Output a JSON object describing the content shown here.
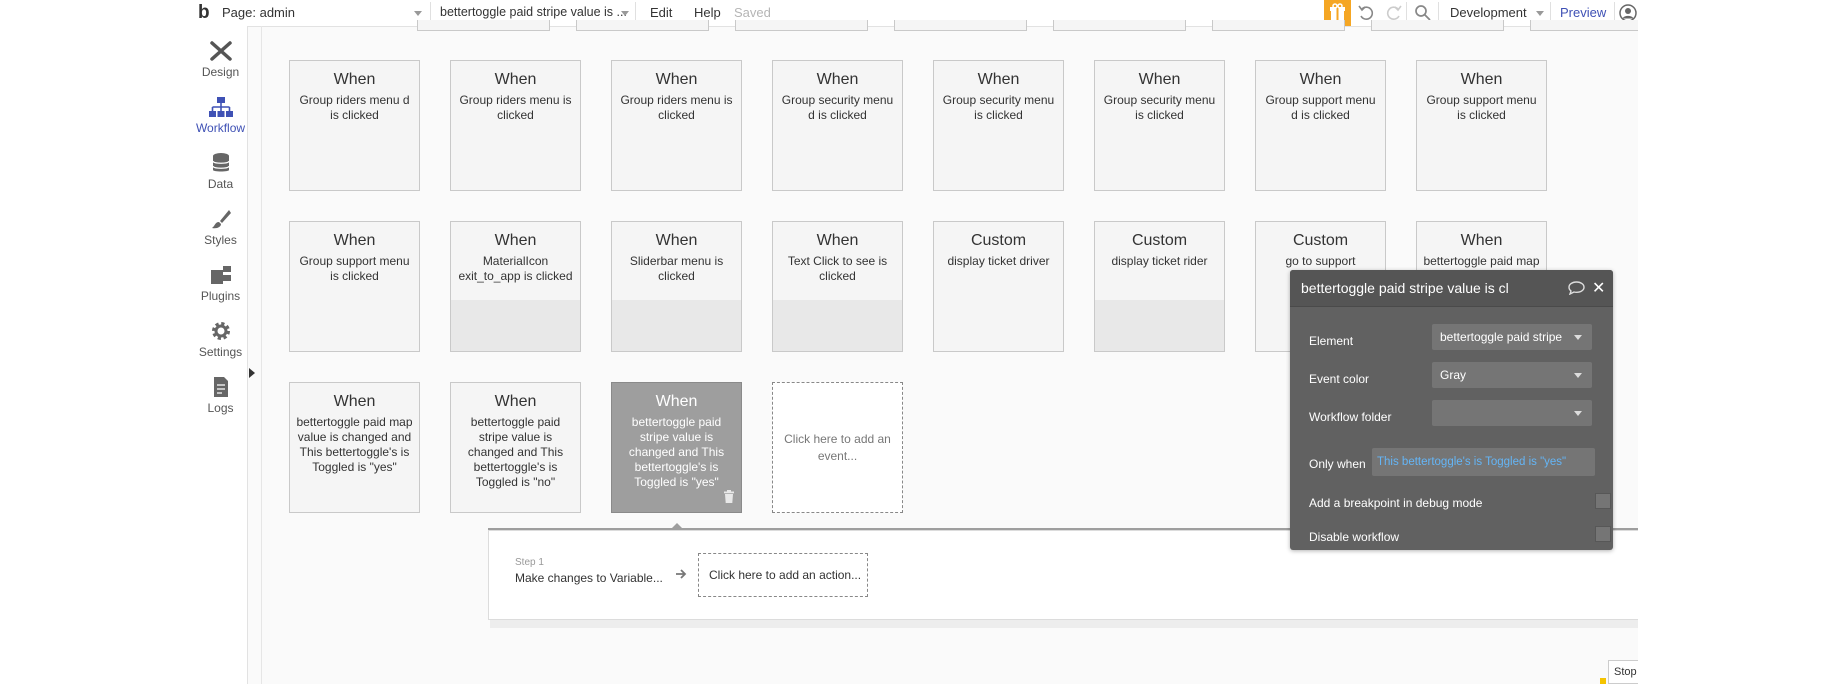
{
  "topbar": {
    "page_selector": "Page: admin",
    "workflow_selector": "bettertoggle paid stripe value is ...",
    "menu_edit": "Edit",
    "menu_help": "Help",
    "save_status": "Saved",
    "environment": "Development",
    "preview": "Preview"
  },
  "sidebar": {
    "items": [
      {
        "label": "Design"
      },
      {
        "label": "Workflow"
      },
      {
        "label": "Data"
      },
      {
        "label": "Styles"
      },
      {
        "label": "Plugins"
      },
      {
        "label": "Settings"
      },
      {
        "label": "Logs"
      }
    ]
  },
  "events": {
    "row1": [
      {
        "kw": "When",
        "desc": "Group riders menu d is clicked"
      },
      {
        "kw": "When",
        "desc": "Group riders menu is clicked"
      },
      {
        "kw": "When",
        "desc": "Group riders menu is clicked"
      },
      {
        "kw": "When",
        "desc": "Group security menu d is clicked"
      },
      {
        "kw": "When",
        "desc": "Group security menu is clicked"
      },
      {
        "kw": "When",
        "desc": "Group security menu is clicked"
      },
      {
        "kw": "When",
        "desc": "Group support menu d is clicked"
      },
      {
        "kw": "When",
        "desc": "Group support menu is clicked"
      }
    ],
    "row2": [
      {
        "kw": "When",
        "desc": "Group support menu is clicked"
      },
      {
        "kw": "When",
        "desc": "MaterialIcon exit_to_app is clicked"
      },
      {
        "kw": "When",
        "desc": "Sliderbar menu is clicked"
      },
      {
        "kw": "When",
        "desc": "Text Click to see is clicked"
      },
      {
        "kw": "Custom",
        "desc": "display ticket driver"
      },
      {
        "kw": "Custom",
        "desc": "display ticket rider"
      },
      {
        "kw": "Custom",
        "desc": "go to support"
      },
      {
        "kw": "When",
        "desc": "bettertoggle paid map"
      }
    ],
    "row3": [
      {
        "kw": "When",
        "desc": "bettertoggle paid map value is changed and This bettertoggle's is Toggled is \"yes\""
      },
      {
        "kw": "When",
        "desc": "bettertoggle paid stripe value is changed and This bettertoggle's is Toggled is \"no\""
      },
      {
        "kw": "When",
        "desc": "bettertoggle paid stripe value is changed and This bettertoggle's is Toggled is \"yes\""
      }
    ],
    "add_event": "Click here to add an event..."
  },
  "panel": {
    "title": "bettertoggle paid stripe value is cl",
    "element_label": "Element",
    "element_value": "bettertoggle paid stripe",
    "event_color_label": "Event color",
    "event_color_value": "Gray",
    "workflow_folder_label": "Workflow folder",
    "workflow_folder_value": "",
    "only_when_label": "Only when",
    "only_when_value": "This bettertoggle's is Toggled is \"yes\"",
    "breakpoint_label": "Add a breakpoint in debug mode",
    "disable_label": "Disable workflow"
  },
  "workflow": {
    "step_label": "Step 1",
    "step_action": "Make changes to Variable...",
    "add_action": "Click here to add an action..."
  },
  "stop_button": "Stop",
  "colors": {
    "accent": "#3f51b5",
    "link": "#64b5f6",
    "gift": "#f5a623",
    "panel_bg": "#616161"
  }
}
